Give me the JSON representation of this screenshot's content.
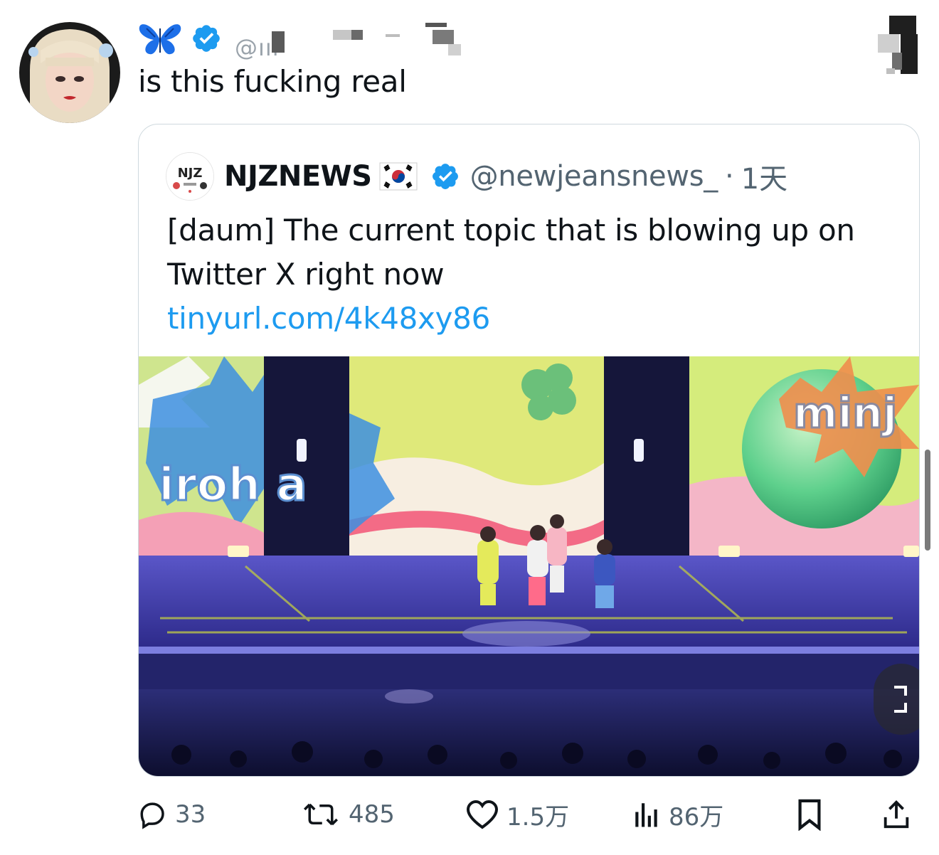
{
  "tweet": {
    "text": "is this fucking real",
    "handle_partial": "@ııı"
  },
  "quote": {
    "name": "NJZNEWS",
    "handle": "@newjeansnews_",
    "separator": "·",
    "time": "1天",
    "text": "[daum] The current topic that is blowing up on Twitter X right now",
    "link": "tinyurl.com/4k48xy86",
    "media_signs": {
      "left": "iroh a",
      "right": "minj"
    }
  },
  "actions": {
    "reply_count": "33",
    "retweet_count": "485",
    "like_count": "1.5万",
    "view_count": "86万"
  },
  "icons": [
    "avatar",
    "butterfly-icon",
    "verified-badge-icon",
    "korea-flag-icon",
    "reply-icon",
    "retweet-icon",
    "like-icon",
    "views-icon",
    "bookmark-icon",
    "share-icon"
  ],
  "colors": {
    "verified": "#1d9bf0",
    "link": "#1d9bf0",
    "muted": "#536471",
    "border": "#cfd9de"
  }
}
